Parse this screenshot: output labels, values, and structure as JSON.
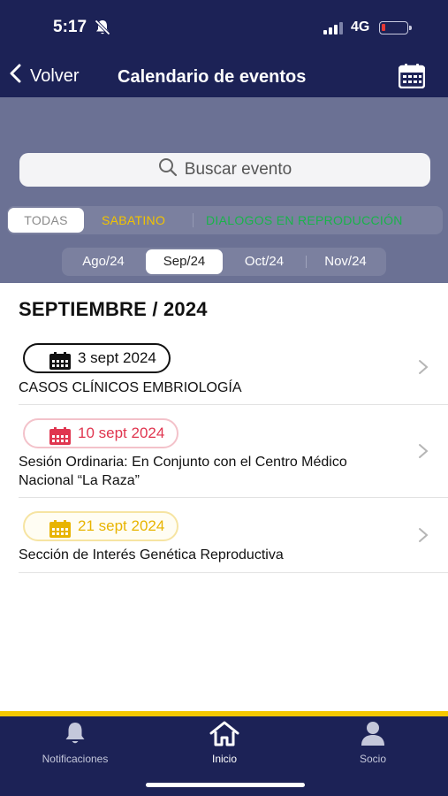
{
  "status": {
    "time": "5:17",
    "network": "4G",
    "battery_level": 0.1,
    "battery_color": "#e53935"
  },
  "nav": {
    "back_label": "Volver",
    "title": "Calendario de eventos"
  },
  "search": {
    "placeholder": "Buscar evento"
  },
  "categories": [
    {
      "label": "TODAS",
      "selected": true,
      "color": "#8a8a8a"
    },
    {
      "label": "SABATINO",
      "selected": false,
      "color": "#f2c300"
    },
    {
      "label": "DIALOGOS EN REPRODUCCIÓN",
      "selected": false,
      "color": "#19b34a"
    }
  ],
  "months": [
    {
      "label": "Ago/24",
      "selected": false
    },
    {
      "label": "Sep/24",
      "selected": true
    },
    {
      "label": "Oct/24",
      "selected": false
    },
    {
      "label": "Nov/24",
      "selected": false
    }
  ],
  "section_title": "SEPTIEMBRE / 2024",
  "events": [
    {
      "date": "3 sept 2024",
      "title": "CASOS CLÍNICOS EMBRIOLOGÍA",
      "color": "#111111",
      "border": "#111111",
      "bg": "#ffffff"
    },
    {
      "date": "10 sept 2024",
      "title": "Sesión Ordinaria: En Conjunto con el Centro Médico Nacional “La Raza”",
      "color": "#e0354f",
      "border": "#f3c2ca",
      "bg": "#ffffff"
    },
    {
      "date": "21 sept 2024",
      "title": "Sección de Interés Genética Reproductiva",
      "color": "#e8b400",
      "border": "#f6e4a2",
      "bg": "#fffdf3"
    }
  ],
  "tabs": [
    {
      "label": "Notificaciones",
      "icon": "bell-icon",
      "active": false
    },
    {
      "label": "Inicio",
      "icon": "home-icon",
      "active": true
    },
    {
      "label": "Socio",
      "icon": "user-icon",
      "active": false
    }
  ],
  "colors": {
    "navy": "#1c2256",
    "filter_bg": "#6b7194",
    "accent_yellow": "#f5c800"
  }
}
